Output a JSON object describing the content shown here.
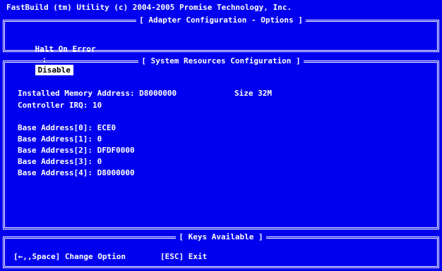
{
  "header": {
    "title": "FastBuild (tm) Utility (c) 2004-2005 Promise Technology, Inc."
  },
  "adapter_options": {
    "title": "[ Adapter Configuration - Options ]",
    "halt_label": "Halt On Error",
    "separator": ":",
    "halt_value": "Disable"
  },
  "system_resources": {
    "title": "[ System Resources Configuration ]",
    "memory_line": "Installed Memory Address: D8000000",
    "size_line": "Size 32M",
    "irq_line": "Controller IRQ: 10",
    "base_addresses": [
      "Base Address[0]: ECE0",
      "Base Address[1]: 0",
      "Base Address[2]: DFDF0000",
      "Base Address[3]: 0",
      "Base Address[4]: D8000000"
    ]
  },
  "keys": {
    "title": "[ Keys Available ]",
    "change_option": "[←,,Space] Change Option",
    "exit": "[ESC] Exit"
  }
}
